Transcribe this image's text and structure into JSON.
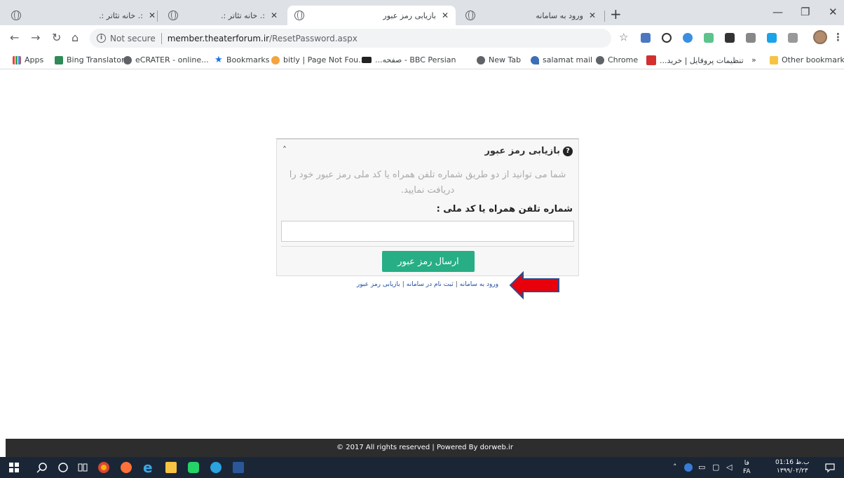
{
  "browser": {
    "tabs": [
      {
        "title": ":. خانه تئاتر :."
      },
      {
        "title": ":. خانه تئاتر :."
      },
      {
        "title": "بازیابی رمز عبور"
      },
      {
        "title": "ورود به سامانه"
      }
    ],
    "omnibox": {
      "security": "Not secure",
      "host": "member.theaterforum.ir",
      "path": "/ResetPassword.aspx"
    },
    "bookmarks": [
      {
        "label": "Apps"
      },
      {
        "label": "Bing Translator"
      },
      {
        "label": "eCRATER - online..."
      },
      {
        "label": "Bookmarks"
      },
      {
        "label": "bitly | Page Not Fou..."
      },
      {
        "label": "BBC Persian - صفحه..."
      },
      {
        "label": "New Tab"
      },
      {
        "label": "salamat mail"
      },
      {
        "label": "Chrome"
      },
      {
        "label": "تنظیمات پروفایل | خرید..."
      },
      {
        "label": "»"
      },
      {
        "label": "Other bookmarks"
      }
    ]
  },
  "page": {
    "panel_title": "بازیابی رمز عبور",
    "description": "شما می توانید از دو طریق شماره تلفن همراه یا کد ملی رمز عبور خود را دریافت نمایید.",
    "field_label": "شماره تلفن همراه یا کد ملی :",
    "field_value": "",
    "submit_label": "ارسال رمز عبور",
    "links": {
      "login": "ورود به سامانه",
      "register": "ثبت نام در سامانه",
      "recover": "بازیابی رمز عبور"
    },
    "footer": "© 2017 All rights reserved | Powered By dorweb.ir"
  },
  "taskbar": {
    "lang": "فا",
    "lang_code": "FA",
    "time": "01:16 ب.ظ",
    "date": "۱۳۹۹/۰۲/۲۳"
  },
  "colors": {
    "accent_button": "#27ae85",
    "arrow_fill": "#e8000b",
    "arrow_stroke": "#2f4a8c",
    "footer_bg": "#2d2d2d",
    "taskbar_bg": "#1a2636"
  }
}
